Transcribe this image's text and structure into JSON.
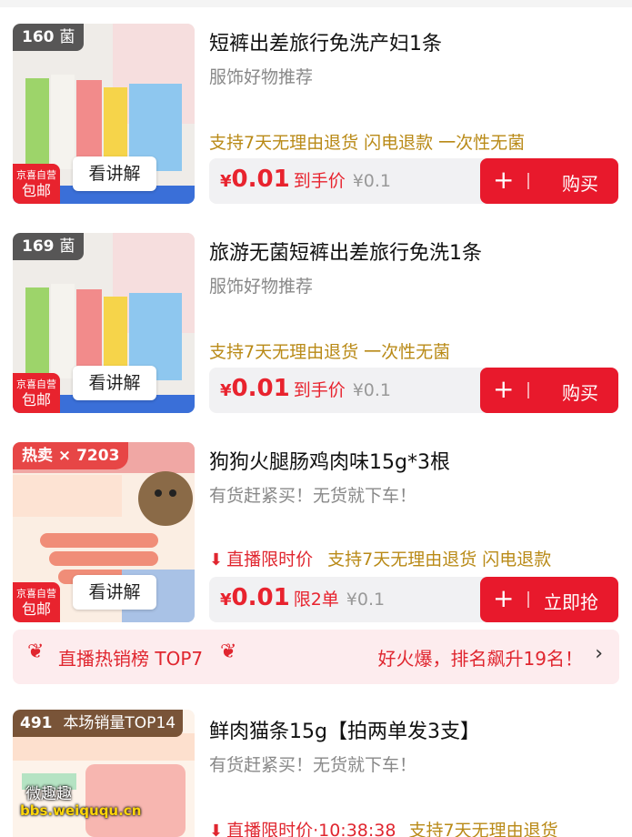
{
  "items": [
    {
      "badge_num": "160",
      "badge_tail": "菌",
      "store_tag_1": "京喜自营",
      "store_tag_2": "包邮",
      "explain_label": "看讲解",
      "title": "短裤出差旅行免洗产妇1条",
      "subtitle": "服饰好物推荐",
      "tags": "支持7天无理由退货  闪电退款  一次性无菌",
      "price_currency": "¥",
      "price_value": "0.01",
      "price_label": "到手价",
      "price_original": "¥0.1",
      "buy_label": "购买",
      "plus_icon": "+"
    },
    {
      "badge_num": "169",
      "badge_tail": "菌",
      "store_tag_1": "京喜自营",
      "store_tag_2": "包邮",
      "explain_label": "看讲解",
      "title": "旅游无菌短裤出差旅行免洗1条",
      "subtitle": "服饰好物推荐",
      "tags": "支持7天无理由退货  一次性无菌",
      "price_currency": "¥",
      "price_value": "0.01",
      "price_label": "到手价",
      "price_original": "¥0.1",
      "buy_label": "购买",
      "plus_icon": "+"
    },
    {
      "badge_num": "热卖 × 7203",
      "store_tag_1": "京喜自营",
      "store_tag_2": "包邮",
      "explain_label": "看讲解",
      "title": "狗狗火腿肠鸡肉味15g*3根",
      "subtitle": "有货赶紧买！无货就下车！",
      "tags_live": "直播限时价",
      "tags": "支持7天无理由退货  闪电退款",
      "price_currency": "¥",
      "price_value": "0.01",
      "price_label": "限2单",
      "price_original": "¥0.1",
      "buy_label": "立即抢",
      "plus_icon": "+"
    },
    {
      "badge_num": "491",
      "badge_tail": "本场销量TOP14",
      "title": "鲜肉猫条15g【拍两单发3支】",
      "subtitle": "有货赶紧买！无货就下车！",
      "tags_live": "直播限时价·10:38:38",
      "tags": "支持7天无理由退货"
    }
  ],
  "hot_bar": {
    "left_text": "直播热销榜 TOP7",
    "right_text": "好火爆，排名飙升19名！",
    "chevron": "›"
  },
  "watermark": {
    "name": "微趣趣",
    "url": "bbs.weiququ.cn"
  },
  "colors": {
    "accent_red": "#e8192c",
    "tag_gold": "#b98a17",
    "price_bar_bg": "#f1f1f3",
    "hot_bar_bg": "#fdecee"
  }
}
